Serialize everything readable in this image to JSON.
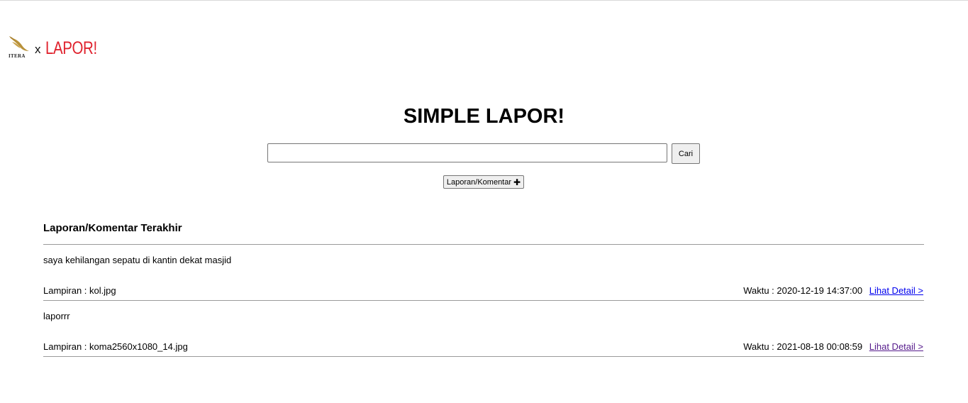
{
  "branding": {
    "itera_text": "ITERA",
    "separator": "x",
    "lapor_text": "LAPOR!",
    "lapor_color": "#e0232e",
    "itera_mark_color": "#b8913a"
  },
  "header": {
    "title": "SIMPLE LAPOR!"
  },
  "search": {
    "value": "",
    "button_label": "Cari"
  },
  "actions": {
    "add_label": "Laporan/Komentar",
    "add_icon": "plus-icon",
    "add_icon_glyph": "✚"
  },
  "reports_section": {
    "heading": "Laporan/Komentar Terakhir",
    "items": [
      {
        "text": "saya kehilangan sepatu di kantin dekat masjid",
        "attachment": "Lampiran : kol.jpg",
        "time": "Waktu : 2020-12-19 14:37:00",
        "detail_label": "Lihat Detail >"
      },
      {
        "text": "laporrr",
        "attachment": "Lampiran : koma2560x1080_14.jpg",
        "time": "Waktu : 2021-08-18 00:08:59",
        "detail_label": "Lihat Detail >"
      }
    ]
  }
}
